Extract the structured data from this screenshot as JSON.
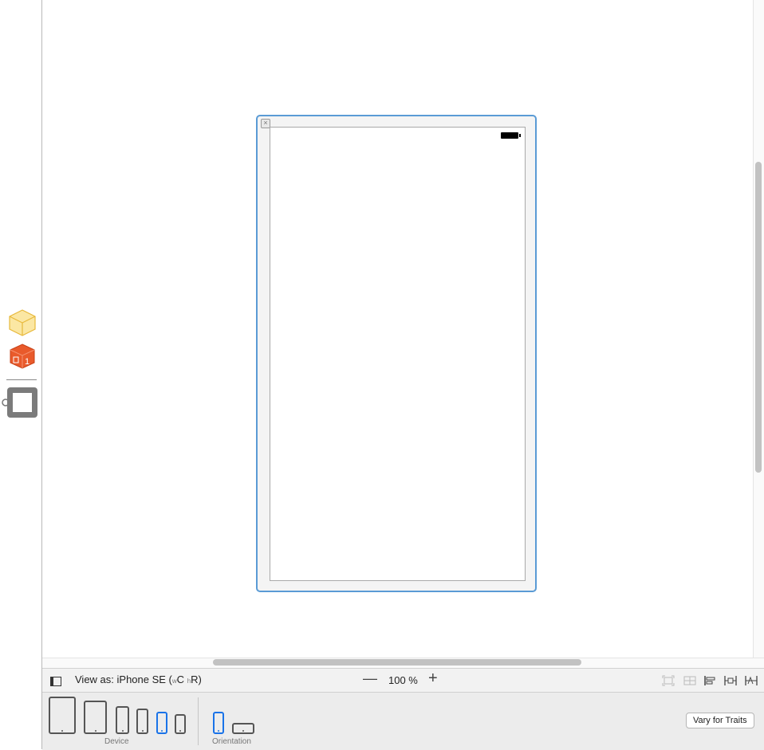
{
  "toolbar": {
    "view_as_prefix": "View as: iPhone SE (",
    "width_class_prefix": "w",
    "width_class": "C",
    "height_class_prefix": "h",
    "height_class": "R)",
    "zoom_out_symbol": "—",
    "zoom_value": "100 %",
    "zoom_in_symbol": "+"
  },
  "scene": {
    "close_symbol": "×",
    "battery_icon": "battery-icon"
  },
  "device_bar": {
    "device_label": "Device",
    "orientation_label": "Orientation",
    "vary_button": "Vary for Traits",
    "selected_device": "iPhone SE",
    "selected_orientation": "portrait"
  },
  "colors": {
    "accent": "#1a73e8",
    "scene_border": "#5a9bd5",
    "cube_yellow": "#f3c64b",
    "cube_orange": "#e95a2b"
  }
}
